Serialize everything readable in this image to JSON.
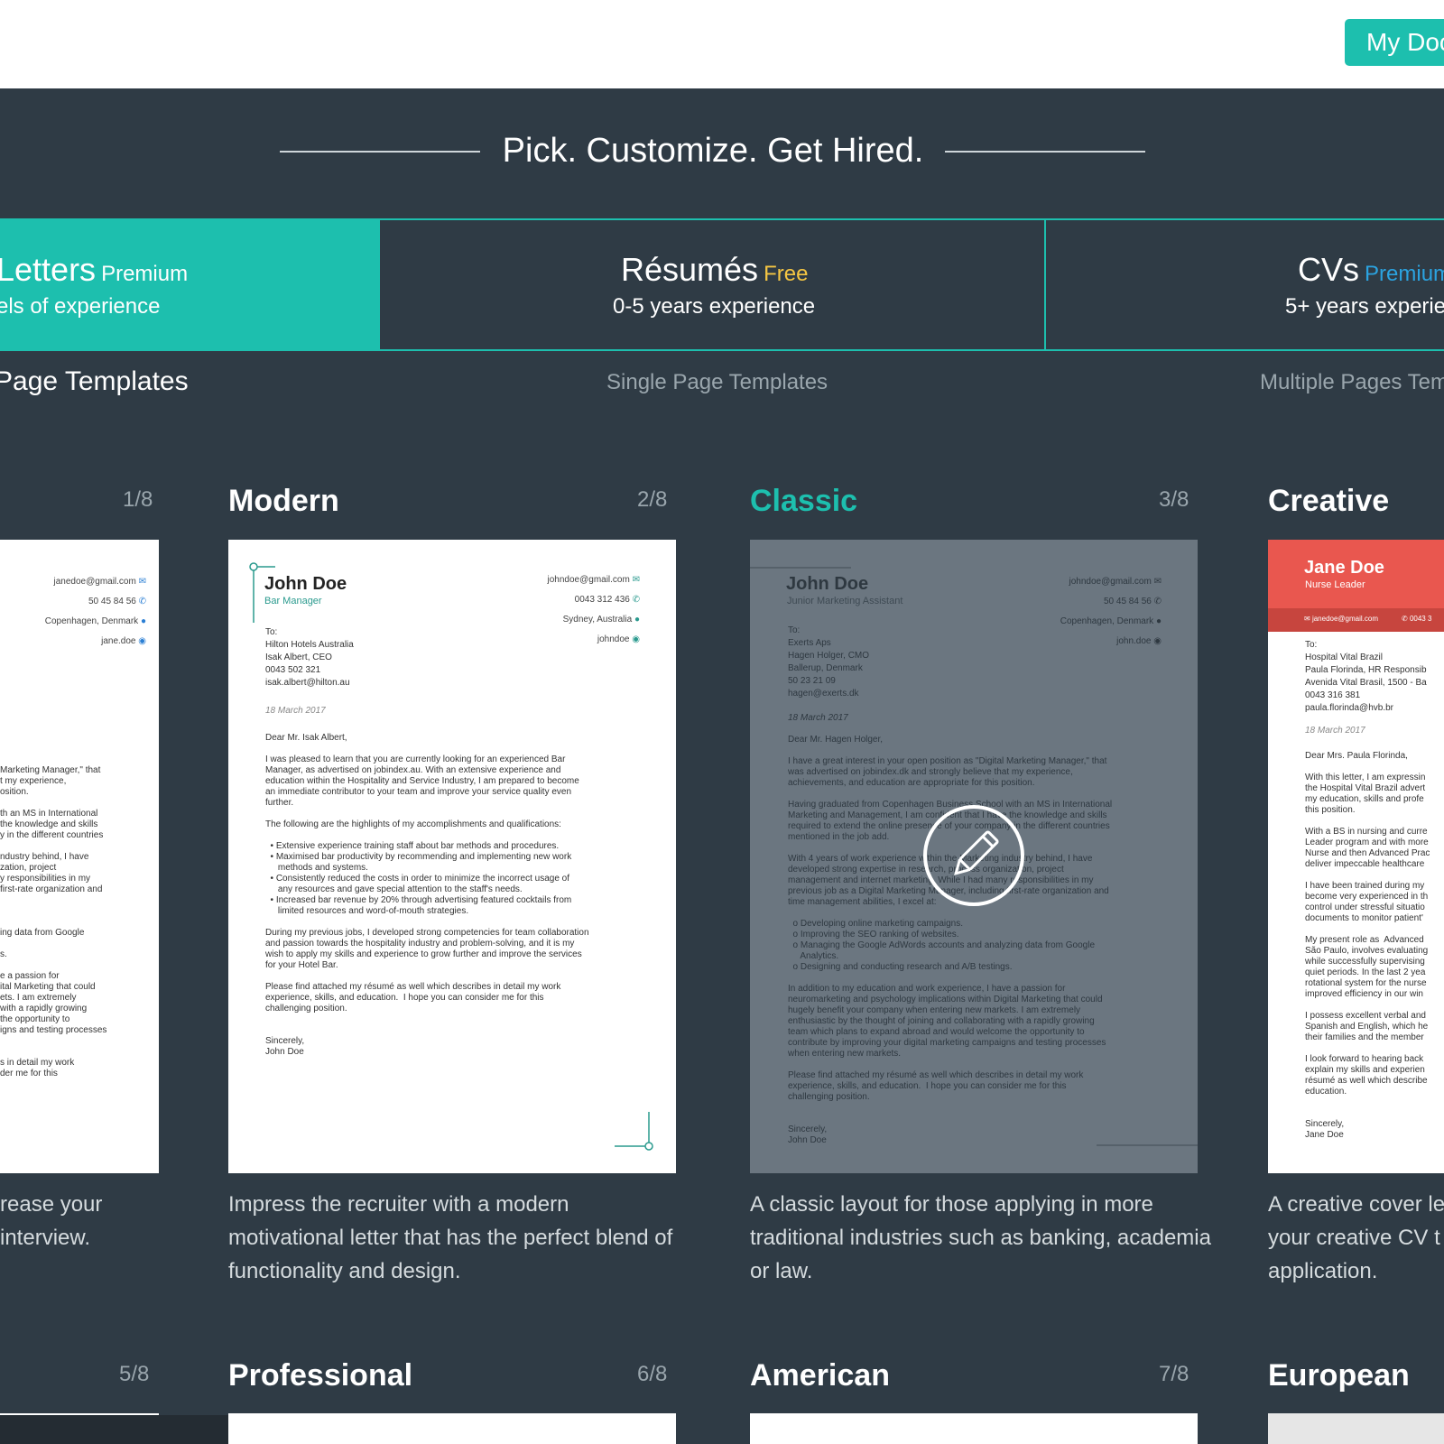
{
  "header": {
    "my_docs_label": "My Doc"
  },
  "hero": {
    "title": "Pick. Customize. Get Hired."
  },
  "tabs": [
    {
      "title": "Letters",
      "badge": "Premium",
      "subtitle": "els of experience",
      "badge_color": "#ffffff"
    },
    {
      "title": "Résumés",
      "badge": "Free",
      "subtitle": "0-5 years experience",
      "badge_color": "#f5c643"
    },
    {
      "title": "CVs",
      "badge": "Premium",
      "subtitle": "5+ years experien",
      "badge_color": "#2ba3e0"
    }
  ],
  "page_templates": [
    "Page Templates",
    "Single Page Templates",
    "Multiple Pages Tem"
  ],
  "cards_row1": [
    {
      "title": "",
      "index": "1/8",
      "desc_lines": [
        "rease your",
        "interview."
      ]
    },
    {
      "title": "Modern",
      "index": "2/8",
      "desc_lines": [
        "Impress the recruiter with a modern",
        "motivational letter that has the perfect blend of",
        "functionality and design."
      ]
    },
    {
      "title": "Classic",
      "index": "3/8",
      "desc_lines": [
        "A classic layout for those applying in more",
        "traditional industries such as banking, academia",
        "or law."
      ]
    },
    {
      "title": "Creative",
      "index": "",
      "desc_lines": [
        "A creative cover le",
        "your creative CV t",
        "application."
      ]
    }
  ],
  "cards_row2": [
    {
      "title": "",
      "index": "5/8"
    },
    {
      "title": "Professional",
      "index": "6/8"
    },
    {
      "title": "American",
      "index": "7/8"
    },
    {
      "title": "European",
      "index": ""
    }
  ],
  "previews": {
    "p1": {
      "contact": [
        "janedoe@gmail.com",
        "50 45 84 56",
        "Copenhagen, Denmark",
        "jane.doe"
      ],
      "body": "Marketing Manager,\" that\nt my experience,\nosition.\n\nth an MS in International\nthe knowledge and skills\ny in the different countries\n\nndustry behind, I have\nzation, project\ny responsibilities in my\nfirst-rate organization and\n\n\n\ning data from Google\n\ns.\n\ne a passion for\nital Marketing that could\nets. I am extremely\nwith a rapidly growing\nthe opportunity to\nigns and testing processes\n\n\ns in detail my work\nder me for this"
    },
    "p2": {
      "name": "John Doe",
      "role": "Bar Manager",
      "contact": [
        "johndoe@gmail.com",
        "0043 312 436",
        "Sydney, Australia",
        "johndoe"
      ],
      "recipient": "To:\nHilton Hotels Australia\nIsak Albert, CEO\n0043 502 321\nisak.albert@hilton.au",
      "date": "18 March 2017",
      "body": "Dear Mr. Isak Albert,\n\nI was pleased to learn that you are currently looking for an experienced Bar\nManager, as advertised on jobindex.au. With an extensive experience and\neducation within the Hospitality and Service Industry, I am prepared to become\nan immediate contributor to your team and improve your service quality even\nfurther.\n\nThe following are the highlights of my accomplishments and qualifications:\n\n  • Extensive experience training staff about bar methods and procedures.\n  • Maximised bar productivity by recommending and implementing new work\n     methods and systems.\n  • Consistently reduced the costs in order to minimize the incorrect usage of\n     any resources and gave special attention to the staff's needs.\n  • Increased bar revenue by 20% through advertising featured cocktails from\n     limited resources and word-of-mouth strategies.\n\nDuring my previous jobs, I developed strong competencies for team collaboration\nand passion towards the hospitality industry and problem-solving, and it is my\nwish to apply my skills and experience to grow further and improve the services\nfor your Hotel Bar.\n\nPlease find attached my résumé as well which describes in detail my work\nexperience, skills, and education.  I hope you can consider me for this\nchallenging position.\n\n\nSincerely,\nJohn Doe"
    },
    "p3": {
      "name": "John Doe",
      "role": "Junior Marketing Assistant",
      "contact": [
        "johndoe@gmail.com",
        "50 45 84 56",
        "Copenhagen, Denmark",
        "john.doe"
      ],
      "recipient": "To:\nExerts Aps\nHagen Holger, CMO\nBallerup, Denmark\n50 23 21 09\nhagen@exerts.dk",
      "date": "18 March 2017",
      "body": "Dear Mr. Hagen Holger,\n\nI have a great interest in your open position as \"Digital Marketing Manager,\" that\nwas advertised on jobindex.dk and strongly believe that my experience,\nachievements, and education are appropriate for this position.\n\nHaving graduated from Copenhagen Business School with an MS in International\nMarketing and Management, I am confident that I have the knowledge and skills\nrequired to extend the online presence of your company in the different countries\nmentioned in the job add.\n\nWith 4 years of work experience within the Marketing industry behind, I have\ndeveloped strong expertise in research, process organization, project\nmanagement and internet marketing. While I had many responsibilities in my\nprevious job as a Digital Marketing Manager, including first-rate organization and\ntime management abilities, I excel at:\n\n  o Developing online marketing campaigns.\n  o Improving the SEO ranking of websites.\n  o Managing the Google AdWords accounts and analyzing data from Google\n     Analytics.\n  o Designing and conducting research and A/B testings.\n\nIn addition to my education and work experience, I have a passion for\nneuromarketing and psychology implications within Digital Marketing that could\nhugely benefit your company when entering new markets. I am extremely\nenthusiastic by the thought of joining and collaborating with a rapidly growing\nteam which plans to expand abroad and would welcome the opportunity to\ncontribute by improving your digital marketing campaigns and testing processes\nwhen entering new markets.\n\nPlease find attached my résumé as well which describes in detail my work\nexperience, skills, and education.  I hope you can consider me for this\nchallenging position.\n\n\nSincerely,\nJohn Doe"
    },
    "p4": {
      "name": "Jane Doe",
      "role": "Nurse Leader",
      "band_email": "janedoe@gmail.com",
      "band_phone": "0043 3",
      "recipient": "To:\nHospital Vital Brazil\nPaula Florinda, HR Responsib\nAvenida Vital Brasil, 1500 - Ba\n0043 316 381\npaula.florinda@hvb.br",
      "date": "18 March 2017",
      "body": "Dear Mrs. Paula Florinda,\n\nWith this letter, I am expressin\nthe Hospital Vital Brazil advert\nmy education, skills and profe\nthis position.\n\nWith a BS in nursing and curre\nLeader program and with more\nNurse and then Advanced Prac\ndeliver impeccable healthcare\n\nI have been trained during my\nbecome very experienced in th\ncontrol under stressful situatio\ndocuments to monitor patient'\n\nMy present role as  Advanced\nSão Paulo, involves evaluating\nwhile successfully supervising\nquiet periods. In the last 2 yea\nrotational system for the nurse\nimproved efficiency in our win\n\nI possess excellent verbal and\nSpanish and English, which he\ntheir families and the member\n\nI look forward to hearing back\nexplain my skills and experien\nrésumé as well which describe\neducation.\n\n\nSincerely,\nJane Doe"
    }
  },
  "icons": [
    "email-icon",
    "phone-icon",
    "location-pin-icon",
    "skype-icon",
    "pencil-icon"
  ],
  "colors": {
    "accent": "#1dbfae",
    "background": "#2f3b45",
    "free_badge": "#f5c643",
    "cv_badge": "#2ba3e0",
    "creative_red": "#e9574f"
  }
}
